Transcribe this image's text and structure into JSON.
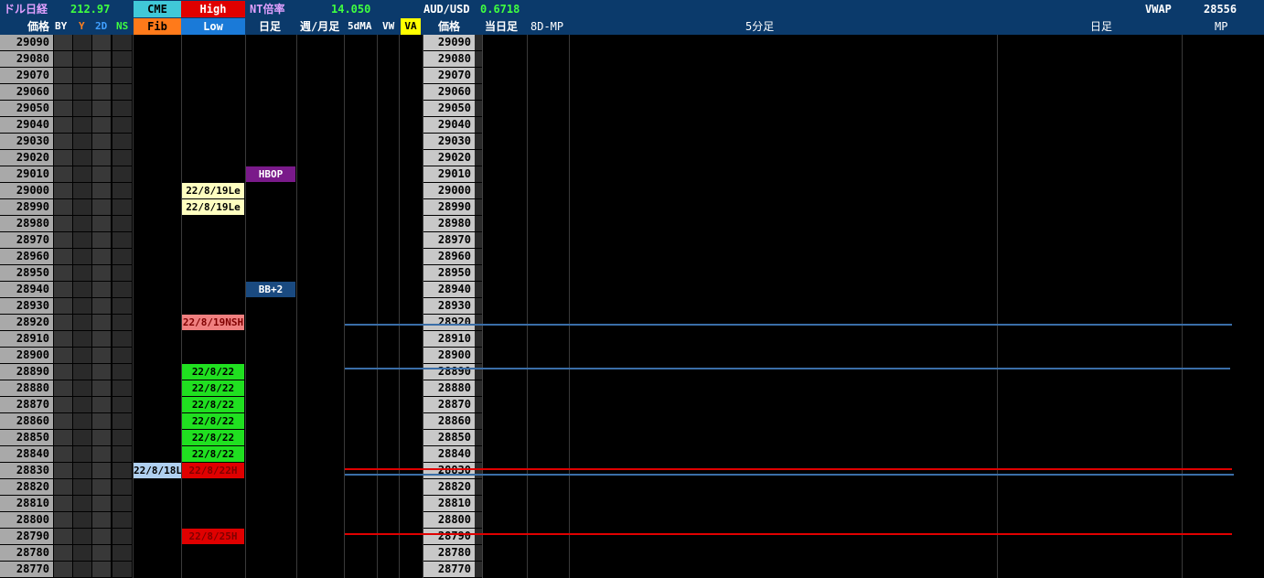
{
  "header": {
    "usd_nikkei_label": "ドル日経",
    "usd_nikkei_value": "212.97",
    "cme_label": "CME",
    "high_label": "High",
    "nt_label": "NT倍率",
    "nt_value": "14.050",
    "audusd_label": "AUD/USD",
    "audusd_value": "0.6718",
    "vwap_label": "VWAP",
    "vwap_value": "28556",
    "price_label": "価格",
    "by_label": "BY",
    "y_label": "Y",
    "twod_label": "2D",
    "ns_label": "NS",
    "fib_label": "Fib",
    "low_label": "Low",
    "daily_label": "日足",
    "weekmonth_label": "週/月足",
    "ma5_label": "5dMA",
    "vw_label": "VW",
    "va_label": "VA",
    "price_label2": "価格",
    "today_label": "当日足",
    "mp8d_label": "8D-MP",
    "min5_label": "5分足",
    "daily_label2": "日足",
    "mp_label": "MP"
  },
  "rows": [
    {
      "price": "29090",
      "low": "",
      "fib": "",
      "daily": ""
    },
    {
      "price": "29080",
      "low": "",
      "fib": "",
      "daily": ""
    },
    {
      "price": "29070",
      "low": "",
      "fib": "",
      "daily": ""
    },
    {
      "price": "29060",
      "low": "",
      "fib": "",
      "daily": ""
    },
    {
      "price": "29050",
      "low": "",
      "fib": "",
      "daily": ""
    },
    {
      "price": "29040",
      "low": "",
      "fib": "",
      "daily": ""
    },
    {
      "price": "29030",
      "low": "",
      "fib": "",
      "daily": ""
    },
    {
      "price": "29020",
      "low": "",
      "fib": "",
      "daily": ""
    },
    {
      "price": "29010",
      "low": "",
      "fib": "",
      "daily": "HBOP"
    },
    {
      "price": "29000",
      "low": "22/8/19Le",
      "fib": "",
      "daily": ""
    },
    {
      "price": "28990",
      "low": "22/8/19Le",
      "fib": "",
      "daily": ""
    },
    {
      "price": "28980",
      "low": "",
      "fib": "",
      "daily": ""
    },
    {
      "price": "28970",
      "low": "",
      "fib": "",
      "daily": ""
    },
    {
      "price": "28960",
      "low": "",
      "fib": "",
      "daily": ""
    },
    {
      "price": "28950",
      "low": "",
      "fib": "",
      "daily": ""
    },
    {
      "price": "28940",
      "low": "",
      "fib": "",
      "daily": "BB+2"
    },
    {
      "price": "28930",
      "low": "",
      "fib": "",
      "daily": ""
    },
    {
      "price": "28920",
      "low": "22/8/19NSH",
      "fib": "",
      "daily": ""
    },
    {
      "price": "28910",
      "low": "",
      "fib": "",
      "daily": ""
    },
    {
      "price": "28900",
      "low": "",
      "fib": "",
      "daily": ""
    },
    {
      "price": "28890",
      "low": "22/8/22",
      "fib": "",
      "daily": ""
    },
    {
      "price": "28880",
      "low": "22/8/22",
      "fib": "",
      "daily": ""
    },
    {
      "price": "28870",
      "low": "22/8/22",
      "fib": "",
      "daily": ""
    },
    {
      "price": "28860",
      "low": "22/8/22",
      "fib": "",
      "daily": ""
    },
    {
      "price": "28850",
      "low": "22/8/22",
      "fib": "",
      "daily": ""
    },
    {
      "price": "28840",
      "low": "22/8/22",
      "fib": "",
      "daily": ""
    },
    {
      "price": "28830",
      "low": "22/8/22H",
      "fib": "22/8/18L",
      "daily": ""
    },
    {
      "price": "28820",
      "low": "",
      "fib": "",
      "daily": ""
    },
    {
      "price": "28810",
      "low": "",
      "fib": "",
      "daily": ""
    },
    {
      "price": "28800",
      "low": "",
      "fib": "",
      "daily": ""
    },
    {
      "price": "28790",
      "low": "22/8/25H",
      "fib": "",
      "daily": ""
    },
    {
      "price": "28780",
      "low": "",
      "fib": "",
      "daily": ""
    },
    {
      "price": "28770",
      "low": "",
      "fib": "",
      "daily": ""
    }
  ],
  "colors": {
    "header_bg": "#0b3a6b",
    "cme": "#40c8d8",
    "high": "#e00000",
    "fib": "#ff7a1a",
    "low": "#1a7ad8",
    "va": "#ffff00",
    "hbop": "#7a1a8a",
    "bb2": "#1a4a80",
    "le": "#ffffc0",
    "nsh": "#f08080",
    "green": "#20e020",
    "red": "#e00000",
    "lblue": "#b0d0f0"
  }
}
